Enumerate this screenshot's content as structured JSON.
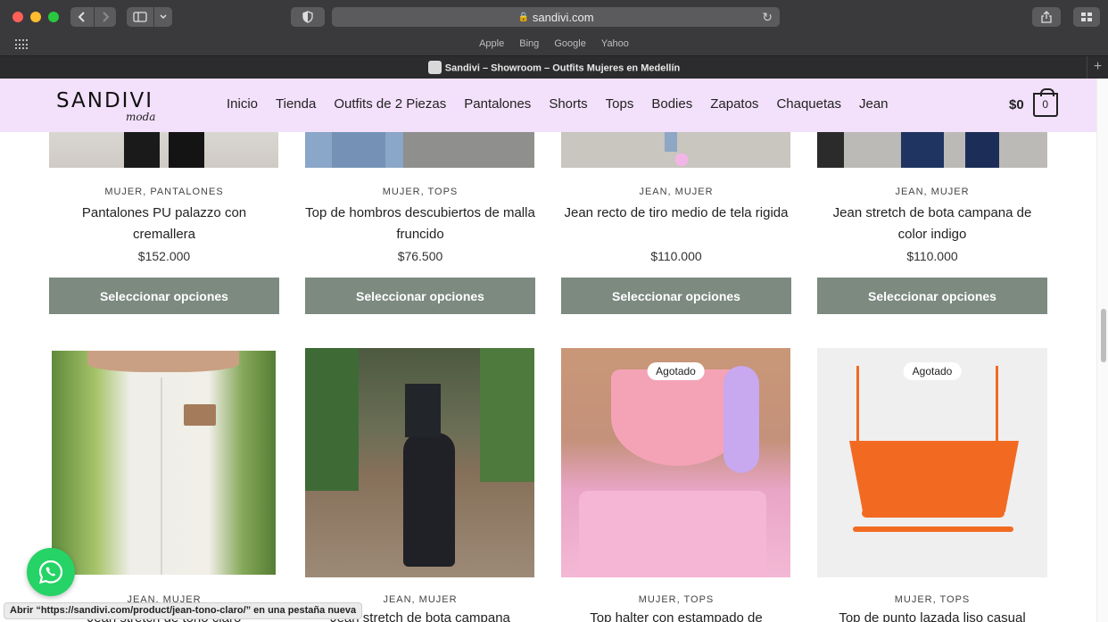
{
  "browser": {
    "url": "sandivi.com",
    "favorites": [
      "Apple",
      "Bing",
      "Google",
      "Yahoo"
    ],
    "tab_title": "Sandivi – Showroom – Outfits Mujeres en Medellín",
    "status_text": "Abrir “https://sandivi.com/product/jean-tono-claro/” en una pestaña nueva"
  },
  "header": {
    "logo": "SANDIVI",
    "logo_sub": "moda",
    "nav": [
      "Inicio",
      "Tienda",
      "Outfits de 2 Piezas",
      "Pantalones",
      "Shorts",
      "Tops",
      "Bodies",
      "Zapatos",
      "Chaquetas",
      "Jean"
    ],
    "cart_total": "$0",
    "cart_count": "0"
  },
  "products_row1": [
    {
      "categories": "MUJER, PANTALONES",
      "name": "Pantalones PU palazzo con cremallera",
      "price": "$152.000",
      "button": "Seleccionar opciones"
    },
    {
      "categories": "MUJER, TOPS",
      "name": "Top de hombros descubiertos de malla fruncido",
      "price": "$76.500",
      "button": "Seleccionar opciones"
    },
    {
      "categories": "JEAN, MUJER",
      "name": "Jean recto de tiro medio de tela rigida",
      "price": "$110.000",
      "button": "Seleccionar opciones"
    },
    {
      "categories": "JEAN, MUJER",
      "name": "Jean stretch de bota campana de color indigo",
      "price": "$110.000",
      "button": "Seleccionar opciones"
    }
  ],
  "products_row2": [
    {
      "categories": "JEAN, MUJER",
      "name": "Jean stretch de tono claro",
      "badge": ""
    },
    {
      "categories": "JEAN, MUJER",
      "name": "Jean stretch de bota campana",
      "badge": ""
    },
    {
      "categories": "MUJER, TOPS",
      "name": "Top halter con estampado de",
      "badge": "Agotado"
    },
    {
      "categories": "MUJER, TOPS",
      "name": "Top de punto lazada liso casual",
      "badge": "Agotado"
    }
  ]
}
